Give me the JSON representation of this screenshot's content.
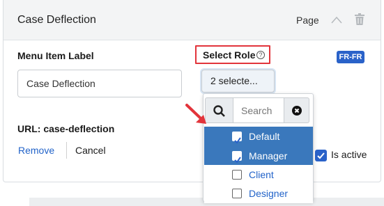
{
  "panel": {
    "title": "Case Deflection",
    "type_label": "Page"
  },
  "form": {
    "menu_item_label": "Menu Item Label",
    "menu_item_value": "Case Deflection",
    "select_role_label": "Select Role",
    "help_glyph": "?",
    "locale_badge": "FR-FR",
    "dropdown_value": "2 selecte...",
    "url_label": "URL: case-deflection",
    "remove_label": "Remove",
    "cancel_label": "Cancel",
    "is_active_label": "Is active",
    "is_active_checked": true
  },
  "role_menu": {
    "search_placeholder": "Search",
    "options": [
      {
        "label": "Default",
        "checked": true
      },
      {
        "label": "Manager",
        "checked": true
      },
      {
        "label": "Client",
        "checked": false
      },
      {
        "label": "Designer",
        "checked": false
      }
    ]
  },
  "colors": {
    "accent": "#2a62c9",
    "selected_row": "#3a78bc",
    "highlight_border": "#e2343b"
  },
  "icons": [
    "chevron-up-icon",
    "trash-icon",
    "help-icon",
    "search-icon",
    "clear-icon",
    "checkbox-icon",
    "arrow-annotation"
  ]
}
